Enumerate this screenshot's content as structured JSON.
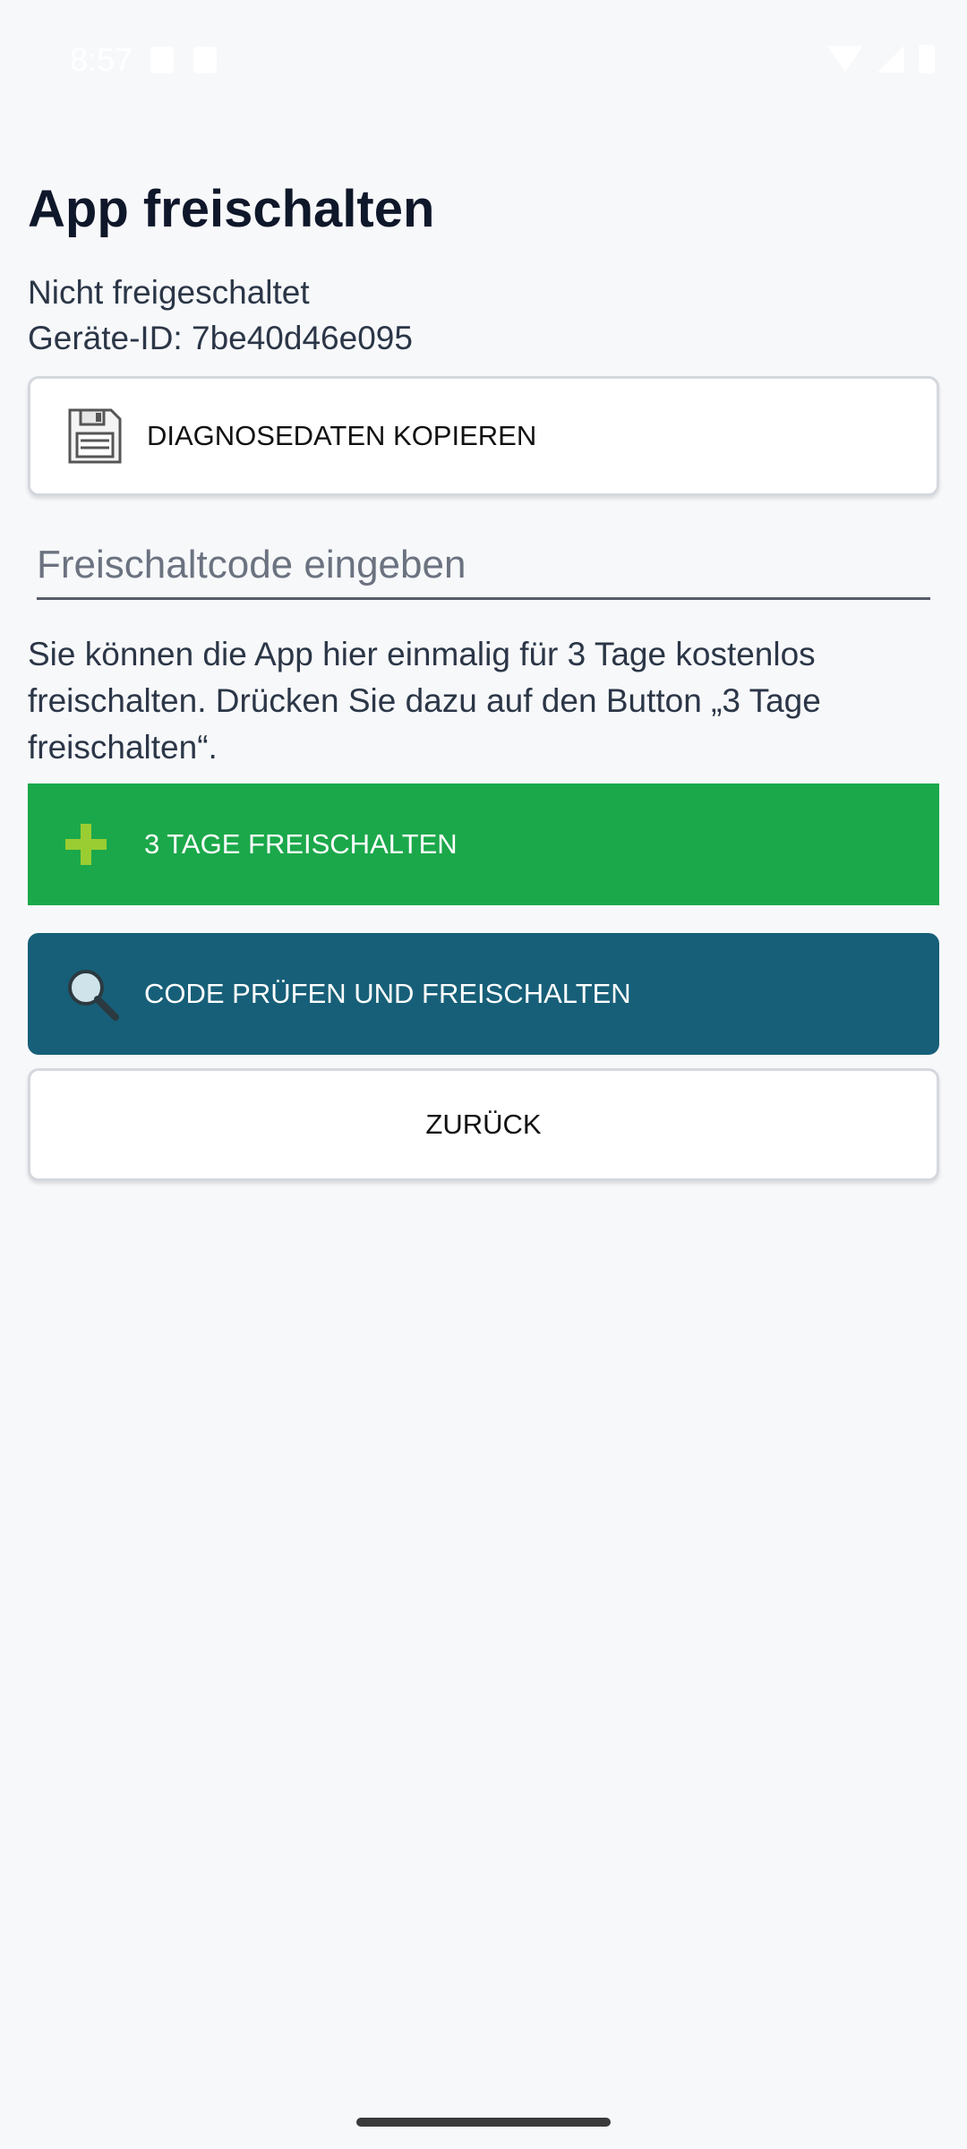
{
  "status_bar": {
    "time": "8:57"
  },
  "page": {
    "title": "App freischalten",
    "status": "Nicht freigeschaltet",
    "device_id": "Geräte-ID: 7be40d46e095"
  },
  "diagnose_button": {
    "label": "DIAGNOSEDATEN KOPIEREN",
    "icon": "floppy-disk-icon"
  },
  "code_input": {
    "placeholder": "Freischaltcode eingeben",
    "value": ""
  },
  "info_text": "Sie können die App hier einmalig für 3 Tage kostenlos freischalten. Drücken Sie dazu auf den Button „3 Tage freischalten“.",
  "trial_button": {
    "label": "3 TAGE FREISCHALTEN",
    "icon": "plus-icon",
    "color": "#1ba84a"
  },
  "check_button": {
    "label": "CODE PRÜFEN UND FREISCHALTEN",
    "icon": "magnifier-icon",
    "color": "#175f78"
  },
  "back_button": {
    "label": "ZURÜCK"
  }
}
